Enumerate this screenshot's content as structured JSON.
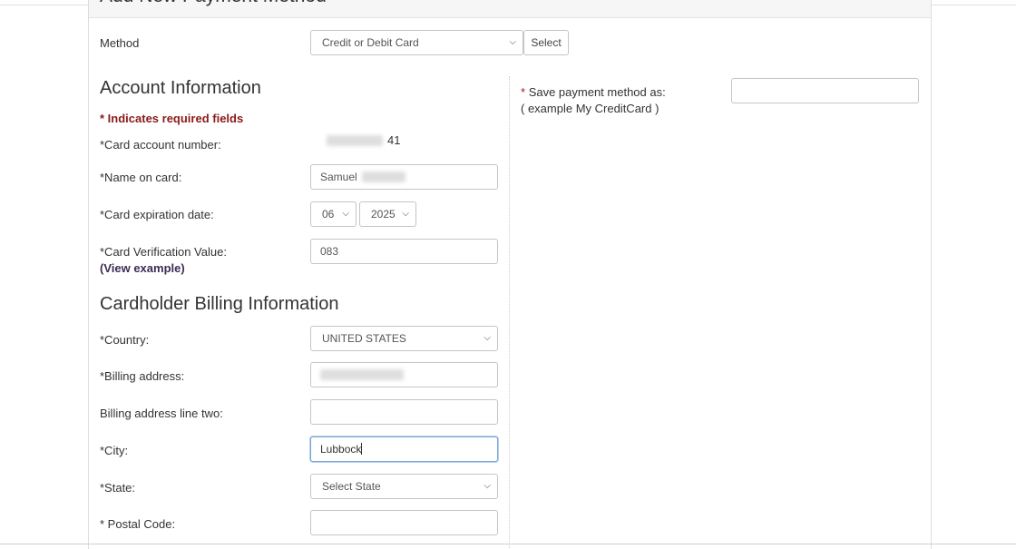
{
  "section_title": "Add New Payment Method",
  "method": {
    "label": "Method",
    "value": "Credit or Debit Card",
    "select_button": "Select"
  },
  "account": {
    "heading": "Account Information",
    "required_note": "* Indicates required fields",
    "card_number_label": "*Card account number:",
    "card_number_suffix": "41",
    "name_label": "*Name on card:",
    "name_value": "Samuel",
    "expiration_label": "*Card expiration date:",
    "exp_month": "06",
    "exp_year": "2025",
    "cvv_label": "*Card Verification Value:",
    "cvv_value": "083",
    "view_example": "(View example)"
  },
  "save_as": {
    "label": "Save payment method as:",
    "example": "( example My CreditCard )",
    "value": ""
  },
  "billing": {
    "heading": "Cardholder Billing Information",
    "country_label": "*Country:",
    "country_value": "UNITED STATES",
    "address_label": "*Billing address:",
    "address2_label": "Billing address line two:",
    "city_label": "*City:",
    "city_value": "Lubbock",
    "state_label": "*State:",
    "state_value": "Select State",
    "postal_label": "* Postal Code:"
  },
  "icons": {
    "dropdown": "chevron-down-icon"
  }
}
